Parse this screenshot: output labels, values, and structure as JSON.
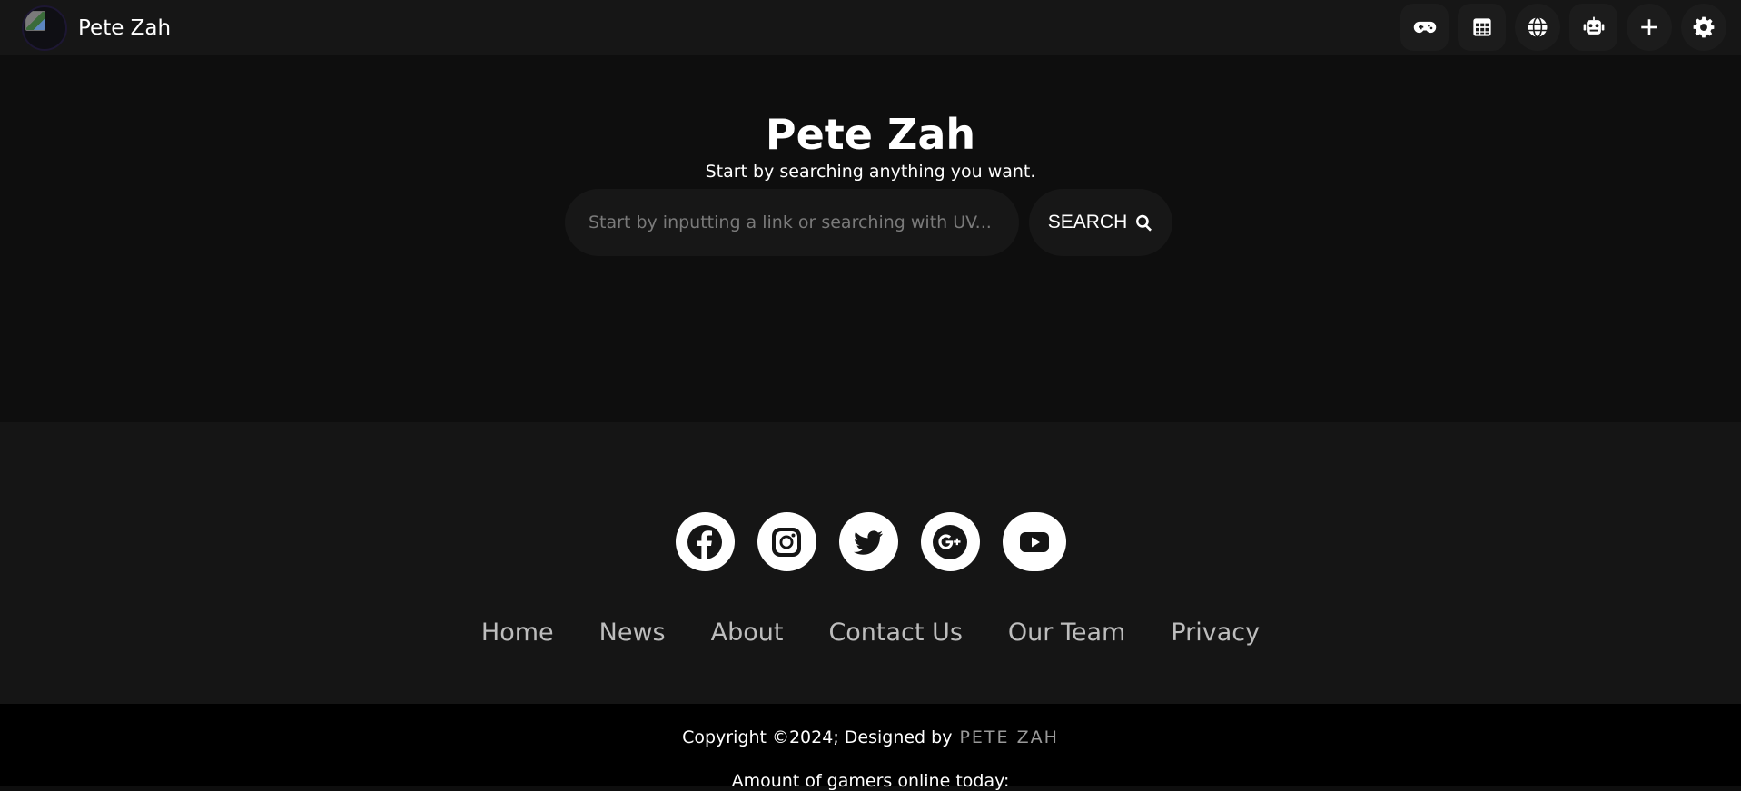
{
  "header": {
    "brand_name": "Pete Zah",
    "actions": [
      {
        "icon": "gamepad-icon"
      },
      {
        "icon": "apps-grid-icon"
      },
      {
        "icon": "globe-icon"
      },
      {
        "icon": "robot-icon"
      },
      {
        "icon": "plus-icon"
      },
      {
        "icon": "gear-icon"
      }
    ]
  },
  "hero": {
    "title": "Pete Zah",
    "subtitle": "Start by searching anything you want.",
    "search_placeholder": "Start by inputting a link or searching with UV...",
    "search_button_label": "SEARCH"
  },
  "footer": {
    "socials": [
      {
        "icon": "facebook-icon"
      },
      {
        "icon": "instagram-icon"
      },
      {
        "icon": "twitter-icon"
      },
      {
        "icon": "google-plus-icon"
      },
      {
        "icon": "youtube-icon"
      }
    ],
    "nav": [
      "Home",
      "News",
      "About",
      "Contact Us",
      "Our Team",
      "Privacy"
    ],
    "copyright": "Copyright ©2024; Designed by",
    "designer": "PETE ZAH",
    "online_text": "Amount of gamers online today:"
  },
  "colors": {
    "page_bg": "#0e0e0e",
    "topbar_bg": "#161616",
    "footer_bg": "#151515",
    "bottom_bg": "#000000",
    "control_bg": "#171717"
  }
}
